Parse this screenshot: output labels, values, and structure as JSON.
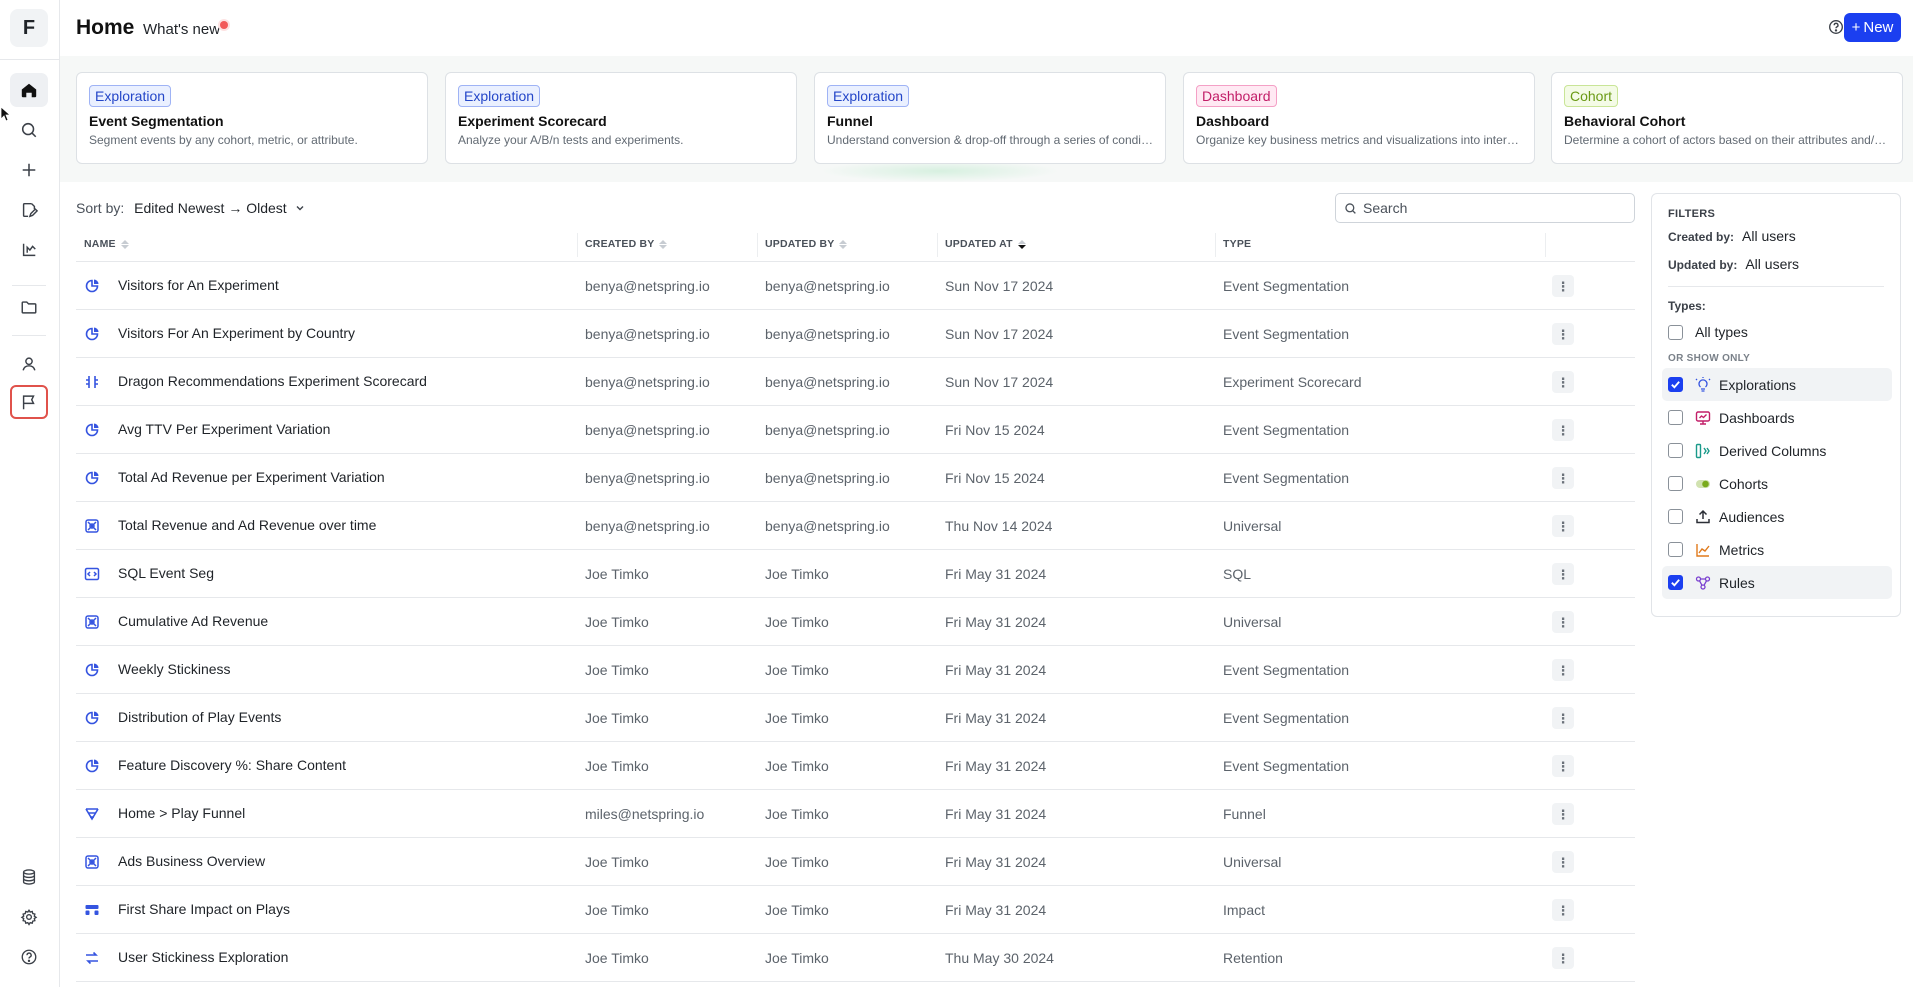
{
  "app": {
    "logo_letter": "F"
  },
  "header": {
    "title": "Home",
    "whats_new": "What's new",
    "new_button": "New"
  },
  "template_cards": [
    {
      "badge": "Exploration",
      "badge_color": "#2446c8",
      "title": "Event Segmentation",
      "desc": "Segment events by any cohort, metric, or attribute."
    },
    {
      "badge": "Exploration",
      "badge_color": "#2446c8",
      "title": "Experiment Scorecard",
      "desc": "Analyze your A/B/n tests and experiments."
    },
    {
      "badge": "Exploration",
      "badge_color": "#2446c8",
      "title": "Funnel",
      "desc": "Understand conversion & drop-off through a series of conditi..."
    },
    {
      "badge": "Dashboard",
      "badge_color": "#c21e68",
      "title": "Dashboard",
      "desc": "Organize key business metrics and visualizations into interacti..."
    },
    {
      "badge": "Cohort",
      "badge_color": "#6a9a14",
      "title": "Behavioral Cohort",
      "desc": "Determine a cohort of actors based on their attributes and/or ..."
    }
  ],
  "sort": {
    "label": "Sort by:",
    "value": "Edited Newest",
    "arrow": "→",
    "value2": "Oldest"
  },
  "search": {
    "placeholder": "Search"
  },
  "table": {
    "columns": [
      "NAME",
      "CREATED BY",
      "UPDATED BY",
      "UPDATED AT",
      "TYPE"
    ],
    "rows": [
      {
        "icon": "pie-chart-icon",
        "name": "Visitors for An Experiment",
        "created_by": "benya@netspring.io",
        "updated_by": "benya@netspring.io",
        "updated_at": "Sun Nov 17 2024",
        "type": "Event Segmentation"
      },
      {
        "icon": "pie-chart-icon",
        "name": "Visitors For An Experiment by Country",
        "created_by": "benya@netspring.io",
        "updated_by": "benya@netspring.io",
        "updated_at": "Sun Nov 17 2024",
        "type": "Event Segmentation"
      },
      {
        "icon": "scorecard-icon",
        "name": "Dragon Recommendations Experiment Scorecard",
        "created_by": "benya@netspring.io",
        "updated_by": "benya@netspring.io",
        "updated_at": "Sun Nov 17 2024",
        "type": "Experiment Scorecard"
      },
      {
        "icon": "pie-chart-icon",
        "name": "Avg TTV Per Experiment Variation",
        "created_by": "benya@netspring.io",
        "updated_by": "benya@netspring.io",
        "updated_at": "Fri Nov 15 2024",
        "type": "Event Segmentation"
      },
      {
        "icon": "pie-chart-icon",
        "name": "Total Ad Revenue per Experiment Variation",
        "created_by": "benya@netspring.io",
        "updated_by": "benya@netspring.io",
        "updated_at": "Fri Nov 15 2024",
        "type": "Event Segmentation"
      },
      {
        "icon": "universal-icon",
        "name": "Total Revenue and Ad Revenue over time",
        "created_by": "benya@netspring.io",
        "updated_by": "benya@netspring.io",
        "updated_at": "Thu Nov 14 2024",
        "type": "Universal"
      },
      {
        "icon": "sql-icon",
        "name": "SQL Event Seg",
        "created_by": "Joe Timko",
        "updated_by": "Joe Timko",
        "updated_at": "Fri May 31 2024",
        "type": "SQL"
      },
      {
        "icon": "universal-icon",
        "name": "Cumulative Ad Revenue",
        "created_by": "Joe Timko",
        "updated_by": "Joe Timko",
        "updated_at": "Fri May 31 2024",
        "type": "Universal"
      },
      {
        "icon": "pie-chart-icon",
        "name": "Weekly Stickiness",
        "created_by": "Joe Timko",
        "updated_by": "Joe Timko",
        "updated_at": "Fri May 31 2024",
        "type": "Event Segmentation"
      },
      {
        "icon": "pie-chart-icon",
        "name": "Distribution of Play Events",
        "created_by": "Joe Timko",
        "updated_by": "Joe Timko",
        "updated_at": "Fri May 31 2024",
        "type": "Event Segmentation"
      },
      {
        "icon": "pie-chart-icon",
        "name": "Feature Discovery %: Share Content",
        "created_by": "Joe Timko",
        "updated_by": "Joe Timko",
        "updated_at": "Fri May 31 2024",
        "type": "Event Segmentation"
      },
      {
        "icon": "funnel-icon",
        "name": "Home > Play Funnel",
        "created_by": "miles@netspring.io",
        "updated_by": "Joe Timko",
        "updated_at": "Fri May 31 2024",
        "type": "Funnel"
      },
      {
        "icon": "universal-icon",
        "name": "Ads Business Overview",
        "created_by": "Joe Timko",
        "updated_by": "Joe Timko",
        "updated_at": "Fri May 31 2024",
        "type": "Universal"
      },
      {
        "icon": "impact-icon",
        "name": "First Share Impact on Plays",
        "created_by": "Joe Timko",
        "updated_by": "Joe Timko",
        "updated_at": "Fri May 31 2024",
        "type": "Impact"
      },
      {
        "icon": "retention-icon",
        "name": "User Stickiness Exploration",
        "created_by": "Joe Timko",
        "updated_by": "Joe Timko",
        "updated_at": "Thu May 30 2024",
        "type": "Retention"
      }
    ]
  },
  "filters": {
    "title": "FILTERS",
    "created_by_label": "Created by:",
    "created_by_value": "All users",
    "updated_by_label": "Updated by:",
    "updated_by_value": "All users",
    "types_label": "Types:",
    "all_types_label": "All types",
    "all_types_checked": false,
    "or_show_only": "OR SHOW ONLY",
    "options": [
      {
        "label": "Explorations",
        "checked": true,
        "icon": "bulb-icon",
        "color": "#3554e0"
      },
      {
        "label": "Dashboards",
        "checked": false,
        "icon": "dashboard-icon",
        "color": "#c21e68"
      },
      {
        "label": "Derived Columns",
        "checked": false,
        "icon": "derived-column-icon",
        "color": "#1a9a8a"
      },
      {
        "label": "Cohorts",
        "checked": false,
        "icon": "cohort-icon",
        "color": "#7aab1c"
      },
      {
        "label": "Audiences",
        "checked": false,
        "icon": "upload-icon",
        "color": "#2b2f36"
      },
      {
        "label": "Metrics",
        "checked": false,
        "icon": "metric-icon",
        "color": "#e07a1c"
      },
      {
        "label": "Rules",
        "checked": true,
        "icon": "rules-icon",
        "color": "#7a3fd0"
      }
    ]
  }
}
